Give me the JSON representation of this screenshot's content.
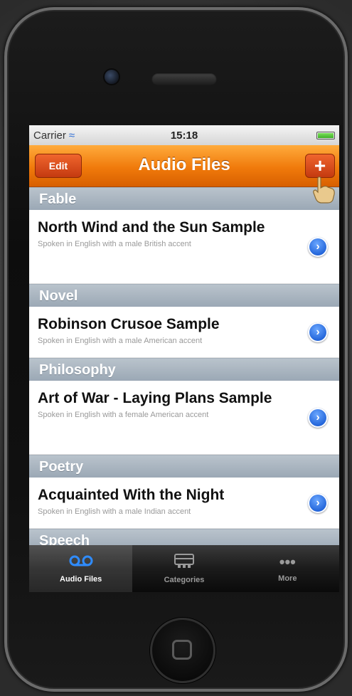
{
  "status_bar": {
    "carrier": "Carrier",
    "time": "15:18"
  },
  "nav": {
    "title": "Audio Files",
    "edit_label": "Edit",
    "add_label": "+"
  },
  "sections": [
    {
      "header": "Fable",
      "items": [
        {
          "title": "North Wind and the Sun Sample",
          "subtitle": "Spoken in English with a male British accent"
        }
      ]
    },
    {
      "header": "Novel",
      "items": [
        {
          "title": "Robinson Crusoe Sample",
          "subtitle": "Spoken in English with a male American accent"
        }
      ]
    },
    {
      "header": "Philosophy",
      "items": [
        {
          "title": "Art of War - Laying Plans Sample",
          "subtitle": "Spoken in English with a female American accent"
        }
      ]
    },
    {
      "header": "Poetry",
      "items": [
        {
          "title": "Acquainted With the Night",
          "subtitle": "Spoken in English with a male Indian accent"
        }
      ]
    },
    {
      "header": "Speech",
      "items": []
    }
  ],
  "tabs": [
    {
      "label": "Audio Files",
      "icon": "voicemail-icon",
      "active": true
    },
    {
      "label": "Categories",
      "icon": "categories-icon",
      "active": false
    },
    {
      "label": "More",
      "icon": "more-icon",
      "active": false
    }
  ],
  "colors": {
    "nav_orange": "#f07a0b",
    "accent_blue": "#1d5fd6"
  }
}
